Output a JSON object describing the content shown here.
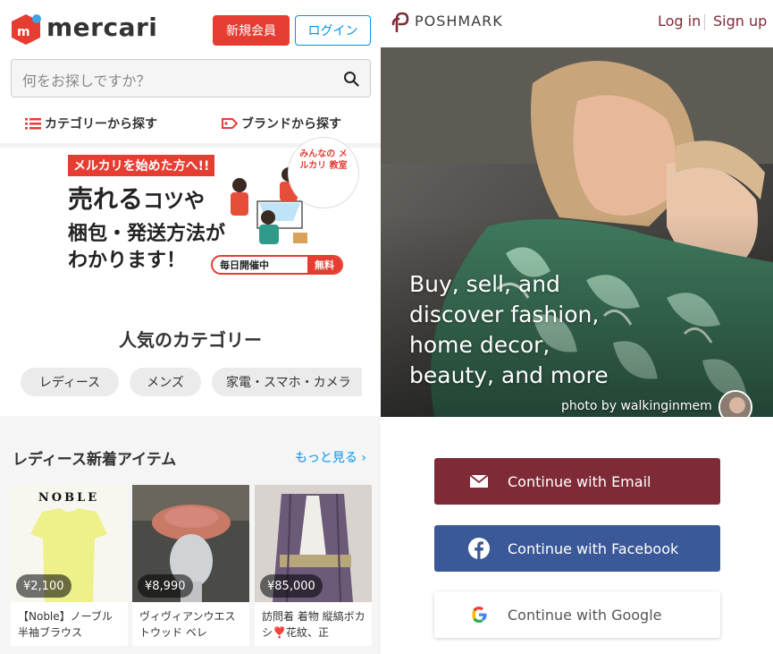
{
  "mercari": {
    "logo_text": "mercari",
    "signup_label": "新規会員",
    "login_label": "ログイン",
    "search_placeholder": "何をお探しですか？",
    "nav": {
      "category_label": "カテゴリーから探す",
      "brand_label": "ブランドから探す"
    },
    "banner": {
      "tag": "メルカリを始めた方へ!!",
      "line1_big": "売れる",
      "line1_small": "コツや",
      "line2": "梱包・発送方法が",
      "line3": "わかります！",
      "pill_text": "毎日開催中",
      "pill_free": "無料",
      "circle_text": "みんなの メルカリ 教室"
    },
    "popular_title": "人気のカテゴリー",
    "chips": [
      "レディース",
      "メンズ",
      "家電・スマホ・カメラ"
    ],
    "section": {
      "title": "レディース新着アイテム",
      "more_label": "もっと見る ›"
    },
    "items": [
      {
        "price": "¥2,100",
        "title": "【Noble】ノーブル 半袖ブラウス",
        "brand_text": "NOBLE"
      },
      {
        "price": "¥8,990",
        "title": "ヴィヴィアンウエストウッド ベレ"
      },
      {
        "price": "¥85,000",
        "title": "訪問着 着物 縦縞ボカシ❣️花紋、正"
      }
    ],
    "colors": {
      "accent": "#e53d32",
      "link": "#0095ee"
    }
  },
  "poshmark": {
    "logo_text": "POSHMARK",
    "login_label": "Log in",
    "signup_label": "Sign up",
    "hero_lines": [
      "Buy, sell, and",
      "discover fashion,",
      "home decor,",
      "beauty, and more"
    ],
    "photo_credit": "photo by walkinginmem",
    "buttons": {
      "email": "Continue with Email",
      "facebook": "Continue with Facebook",
      "google": "Continue with Google"
    },
    "colors": {
      "brand": "#7f2b37",
      "facebook": "#3b5998"
    }
  }
}
